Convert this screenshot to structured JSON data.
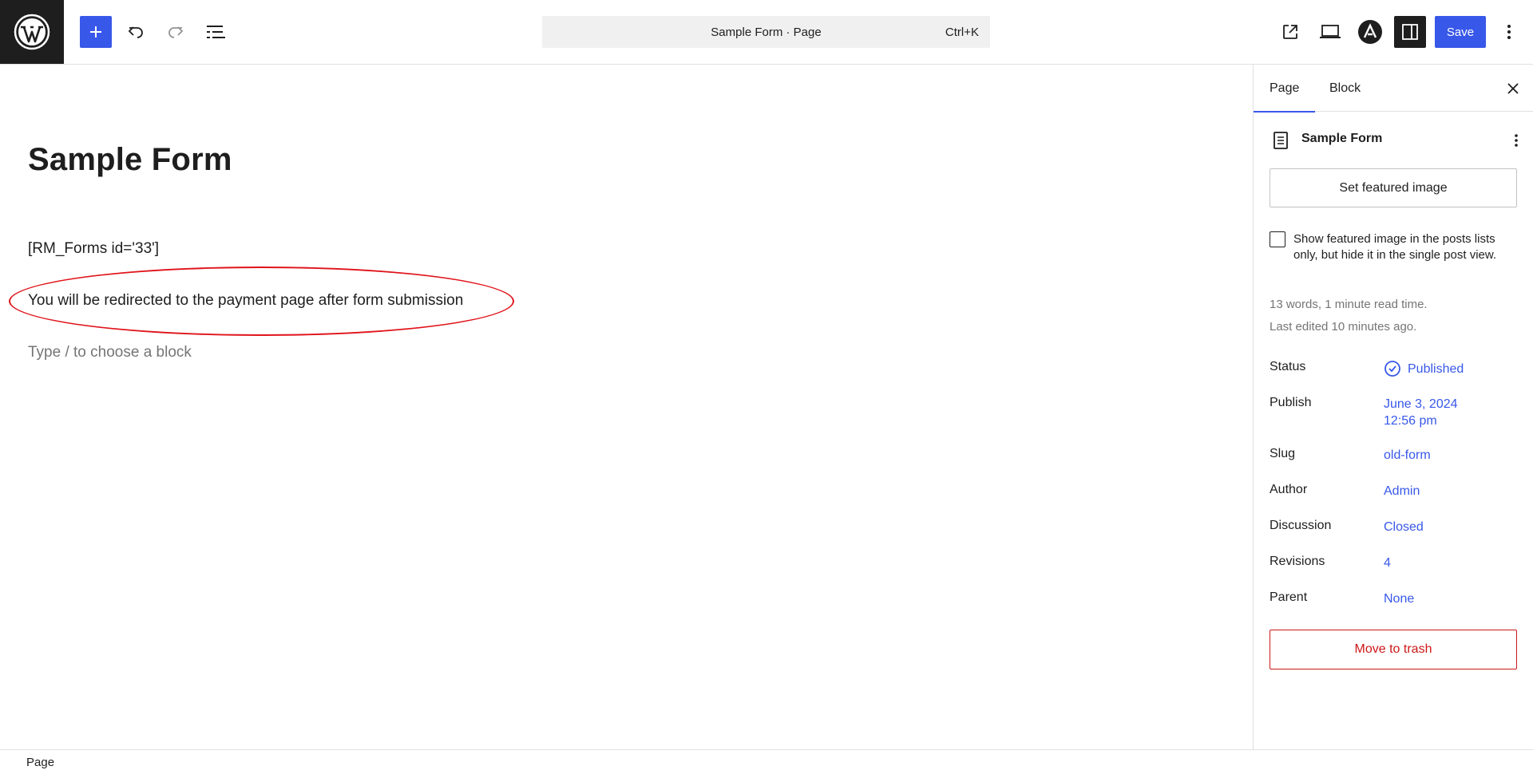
{
  "header": {
    "command_title": "Sample Form · Page",
    "command_shortcut": "Ctrl+K",
    "save_label": "Save"
  },
  "editor": {
    "title": "Sample Form",
    "blocks": [
      {
        "text": "[RM_Forms id='33']"
      },
      {
        "text": "You will be redirected to the payment page after form submission"
      }
    ],
    "placeholder": "Type / to choose a block"
  },
  "sidebar": {
    "tabs": [
      {
        "label": "Page"
      },
      {
        "label": "Block"
      }
    ],
    "document_title": "Sample Form",
    "featured_image_button": "Set featured image",
    "checkbox_label": "Show featured image in the posts lists only, but hide it in the single post view.",
    "meta_words": "13 words, 1 minute read time.",
    "meta_edited": "Last edited 10 minutes ago.",
    "properties": {
      "status": {
        "label": "Status",
        "value": "Published"
      },
      "publish": {
        "label": "Publish",
        "value_date": "June 3, 2024",
        "value_time": "12:56 pm"
      },
      "slug": {
        "label": "Slug",
        "value": "old-form"
      },
      "author": {
        "label": "Author",
        "value": "Admin"
      },
      "discussion": {
        "label": "Discussion",
        "value": "Closed"
      },
      "revisions": {
        "label": "Revisions",
        "value": "4"
      },
      "parent": {
        "label": "Parent",
        "value": "None"
      }
    },
    "trash_button": "Move to trash"
  },
  "footer": {
    "breadcrumb": "Page"
  },
  "colors": {
    "accent": "#3858e9",
    "danger": "#cc1818",
    "annotation": "#e0141b"
  }
}
